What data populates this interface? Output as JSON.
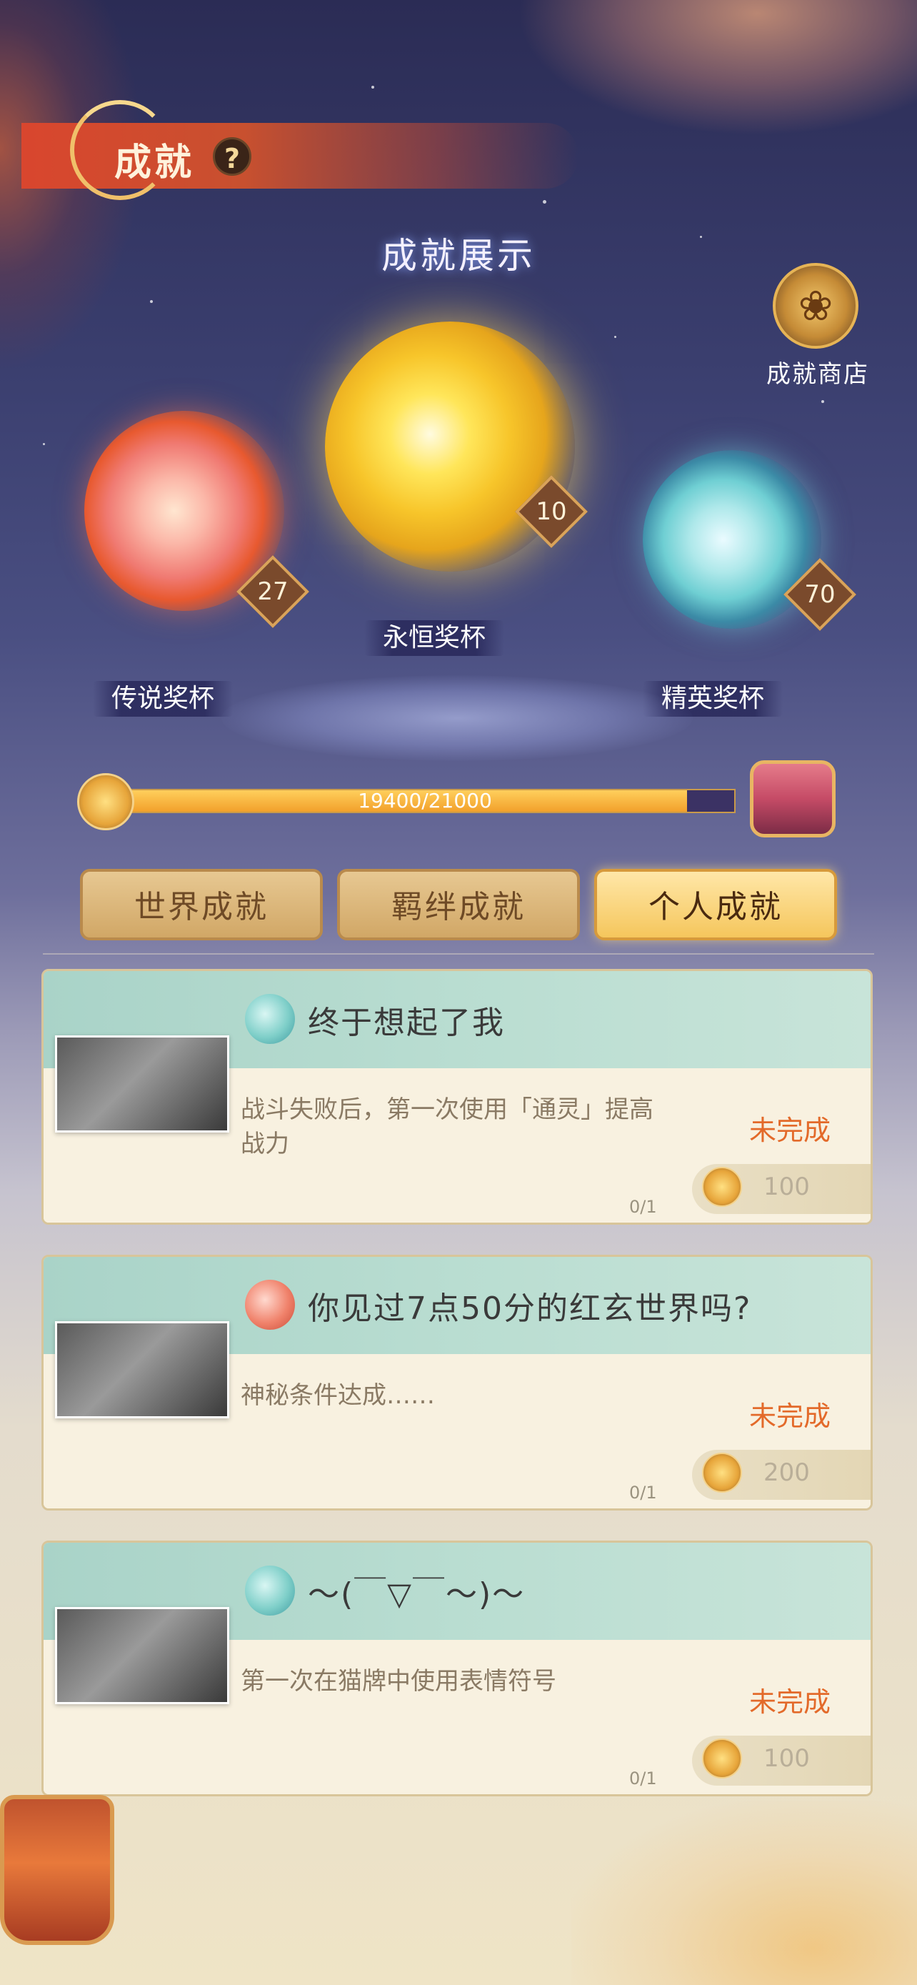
{
  "header": {
    "title": "成就",
    "help_symbol": "?"
  },
  "showcase": {
    "title": "成就展示",
    "trophies": [
      {
        "label": "传说奖杯",
        "count": "27",
        "color": "#f07a72"
      },
      {
        "label": "永恒奖杯",
        "count": "10",
        "color": "#f7c52a"
      },
      {
        "label": "精英奖杯",
        "count": "70",
        "color": "#6fcfd3"
      }
    ],
    "shop": {
      "label": "成就商店",
      "icon": "dragon-lotus-icon"
    }
  },
  "progress": {
    "text": "19400/21000",
    "current": 19400,
    "total": 21000,
    "fraction": 0.9238
  },
  "tabs": [
    {
      "label": "世界成就",
      "active": false
    },
    {
      "label": "羁绊成就",
      "active": false
    },
    {
      "label": "个人成就",
      "active": true
    }
  ],
  "achievements": [
    {
      "title": "终于想起了我",
      "icon": "teal-trophy-icon",
      "description": "战斗失败后，第一次使用「通灵」提高战力",
      "status": "未完成",
      "reward": "100",
      "progress": "0/1"
    },
    {
      "title": "你见过7点50分的红玄世界吗?",
      "icon": "red-trophy-icon",
      "description": "神秘条件达成……",
      "status": "未完成",
      "reward": "200",
      "progress": "0/1"
    },
    {
      "title": "～(￣▽￣～)～",
      "icon": "teal-trophy-icon",
      "description": "第一次在猫牌中使用表情符号",
      "status": "未完成",
      "reward": "100",
      "progress": "0/1"
    }
  ],
  "colors": {
    "accent": "#e36a2a",
    "tab_active": "#f5c65c",
    "banner": "#d9462e",
    "progress_fill": "#f2a02b"
  }
}
